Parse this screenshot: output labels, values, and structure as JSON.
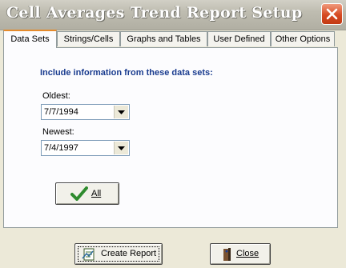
{
  "window": {
    "title": "Cell Averages Trend Report Setup"
  },
  "tabs": [
    {
      "label": "Data Sets",
      "active": true
    },
    {
      "label": "Strings/Cells",
      "active": false
    },
    {
      "label": "Graphs and Tables",
      "active": false
    },
    {
      "label": "User Defined",
      "active": false
    },
    {
      "label": "Other Options",
      "active": false
    }
  ],
  "data_sets": {
    "heading": "Include information from these data sets:",
    "oldest": {
      "label": "Oldest:",
      "value": "7/7/1994"
    },
    "newest": {
      "label": "Newest:",
      "value": "7/4/1997"
    },
    "all_button": "All"
  },
  "footer": {
    "create_report": "Create Report",
    "close": "Close"
  },
  "icons": {
    "close": "close-icon",
    "dropdown": "dropdown-arrow-icon",
    "all": "checkmark-icon",
    "create_report": "report-icon",
    "close_button": "door-exit-icon"
  }
}
